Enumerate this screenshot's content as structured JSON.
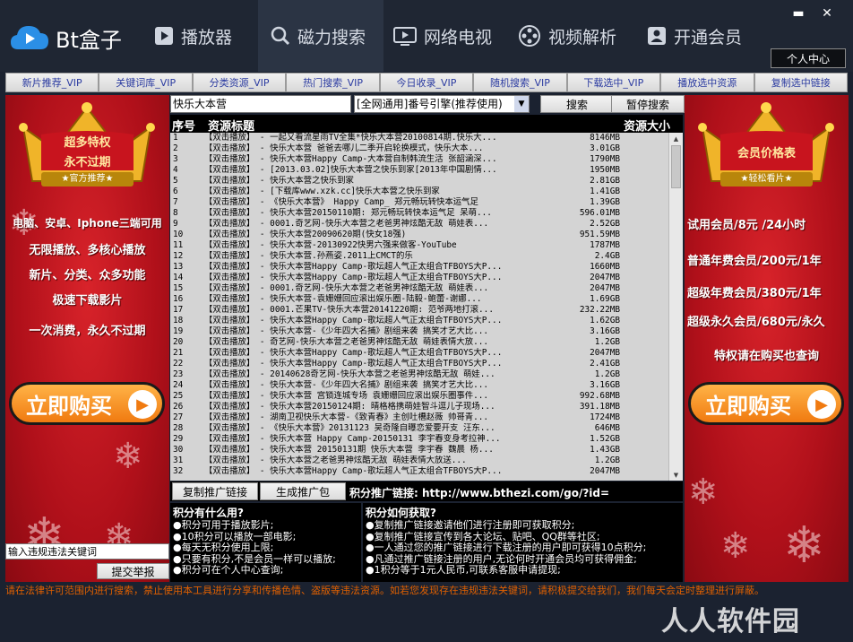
{
  "app": {
    "name": "Bt盒子",
    "user_center": "个人中心"
  },
  "nav": [
    {
      "label": "播放器",
      "icon": "play-icon"
    },
    {
      "label": "磁力搜索",
      "icon": "search-icon"
    },
    {
      "label": "网络电视",
      "icon": "tv-icon"
    },
    {
      "label": "视频解析",
      "icon": "film-reel-icon"
    },
    {
      "label": "开通会员",
      "icon": "user-badge-icon"
    }
  ],
  "window": {
    "minimize": "▬",
    "close": "✕"
  },
  "tabs": [
    "新片推荐_VIP",
    "关键词库_VIP",
    "分类资源_VIP",
    "热门搜索_VIP",
    "今日收录_VIP",
    "随机搜索_VIP",
    "下载选中_VIP",
    "播放选中资源",
    "复制选中链接"
  ],
  "search": {
    "query": "快乐大本营",
    "engine": "[全网通用]番号引擎(推荐使用)",
    "search_btn": "搜索",
    "pause_btn": "暂停搜索"
  },
  "list": {
    "headers": {
      "index": "序号",
      "title": "资源标题",
      "size": "资源大小"
    },
    "rows": [
      {
        "n": "1",
        "t": "【双击播放】 - 一起又看流星雨TV全集*快乐大本营20100814期.快乐大...",
        "s": "8146MB"
      },
      {
        "n": "2",
        "t": "【双击播放】 - 快乐大本营 爸爸去哪儿二季开启轮换模式，快乐大本...",
        "s": "3.01GB"
      },
      {
        "n": "3",
        "t": "【双击播放】 - 快乐大本营Happy Camp-大本营自制韩流生活 张韶涵深...",
        "s": "1790MB"
      },
      {
        "n": "4",
        "t": "【双击播放】 - [2013.03.02]快乐大本营之快乐到家[2013年中国剧情...",
        "s": "1950MB"
      },
      {
        "n": "5",
        "t": "【双击播放】 - 快乐大本营之快乐到家",
        "s": "2.81GB"
      },
      {
        "n": "6",
        "t": "【双击播放】 - [下载库www.xzk.cc]快乐大本营之快乐到家",
        "s": "1.41GB"
      },
      {
        "n": "7",
        "t": "【双击播放】 - 《快乐大本营》 Happy Camp_ 郑元畅玩转快本运气足",
        "s": "1.39GB"
      },
      {
        "n": "8",
        "t": "【双击播放】 - 快乐大本营20150110期: 郑元畅玩转快本运气足 呆萌...",
        "s": "596.01MB"
      },
      {
        "n": "9",
        "t": "【双击播放】 - 0001.奇艺网-快乐大本营之老爸男神炫酷无敌 萌娃表...",
        "s": "2.52GB"
      },
      {
        "n": "10",
        "t": "【双击播放】 - 快乐大本营20090620期(快女18强)",
        "s": "951.59MB"
      },
      {
        "n": "11",
        "t": "【双击播放】 - 快乐大本营-20130922快男六强来做客-YouTube",
        "s": "1787MB"
      },
      {
        "n": "12",
        "t": "【双击播放】 - 快乐大本营.孙燕姿.2011上CMCT的乐",
        "s": "2.4GB"
      },
      {
        "n": "13",
        "t": "【双击播放】 - 快乐大本营Happy Camp-歌坛超人气正太组合TFBOYS大P...",
        "s": "1660MB"
      },
      {
        "n": "14",
        "t": "【双击播放】 - 快乐大本营Happy Camp-歌坛超人气正太组合TFBOYS大P...",
        "s": "2047MB"
      },
      {
        "n": "15",
        "t": "【双击播放】 - 0001.奇艺网-快乐大本营之老爸男神炫酷无敌 萌娃表...",
        "s": "2047MB"
      },
      {
        "n": "16",
        "t": "【双击播放】 - 快乐大本营-袁姗姗回应滚出娱乐圈-陆毅-鲍蕾-谢娜...",
        "s": "1.69GB"
      },
      {
        "n": "17",
        "t": "【双击播放】 - 0001.芒果TV-快乐大本营20141220期: 范爷两地打滚...",
        "s": "232.22MB"
      },
      {
        "n": "18",
        "t": "【双击播放】 - 快乐大本营Happy Camp-歌坛超人气正太组合TFBOYS大P...",
        "s": "1.62GB"
      },
      {
        "n": "19",
        "t": "【双击播放】 - 快乐大本营-《少年四大名捕》剧组来袭 搞笑才艺大比...",
        "s": "3.16GB"
      },
      {
        "n": "20",
        "t": "【双击播放】 - 奇艺网-快乐大本营之老爸男神炫酷无敌 萌娃表情大放...",
        "s": "1.2GB"
      },
      {
        "n": "21",
        "t": "【双击播放】 - 快乐大本营Happy Camp-歌坛超人气正太组合TFBOYS大P...",
        "s": "2047MB"
      },
      {
        "n": "22",
        "t": "【双击播放】 - 快乐大本营Happy Camp-歌坛超人气正太组合TFBOYS大P...",
        "s": "2.41GB"
      },
      {
        "n": "23",
        "t": "【双击播放】 - 20140628奇艺网-快乐大本营之老爸男神炫酷无敌 萌娃...",
        "s": "1.2GB"
      },
      {
        "n": "24",
        "t": "【双击播放】 - 快乐大本营-《少年四大名捕》剧组来袭 搞笑才艺大比...",
        "s": "3.16GB"
      },
      {
        "n": "25",
        "t": "【双击播放】 - 快乐大本营 宫锁连城专场 袁姗姗回应滚出娱乐圈事件...",
        "s": "992.68MB"
      },
      {
        "n": "26",
        "t": "【双击播放】 - 快乐大本营20150124期: 晴格格携萌娃智斗逗儿子现场...",
        "s": "391.18MB"
      },
      {
        "n": "27",
        "t": "【双击播放】 - 湖南卫视快乐大本营-《致青春》主创吐槽赵薇 帅哥青...",
        "s": "1724MB"
      },
      {
        "n": "28",
        "t": "【双击播放】 - 《快乐大本营》20131123 吴奇隆自曝恋爱要开支 汪东...",
        "s": "646MB"
      },
      {
        "n": "29",
        "t": "【双击播放】 - 快乐大本营 Happy Camp-20150131 李宇春变身考拉神...",
        "s": "1.52GB"
      },
      {
        "n": "30",
        "t": "【双击播放】 - 快乐大本营 20150131期 快乐大本营 李宇春 魏晨 杨...",
        "s": "1.43GB"
      },
      {
        "n": "31",
        "t": "【双击播放】 - 快乐大本营之老爸男神炫酷无敌 萌娃表情大放送...",
        "s": "1.2GB"
      },
      {
        "n": "32",
        "t": "【双击播放】 - 快乐大本营Happy Camp-歌坛超人气正太组合TFBOYS大P...",
        "s": "2047MB"
      }
    ]
  },
  "link": {
    "copy_btn": "复制推广链接",
    "gen_btn": "生成推广包",
    "label": "积分推广链接: http://www.bthezi.com/go/?id="
  },
  "points_use": {
    "title": "积分有什么用?",
    "items": [
      "●积分可用于播放影片;",
      "●10积分可以播放一部电影;",
      "●每天无积分使用上限;",
      "●只要有积分,不是会员一样可以播放;",
      "●积分可在个人中心查询;"
    ]
  },
  "points_get": {
    "title": "积分如何获取?",
    "items": [
      "●复制推广链接邀请他们进行注册即可获取积分;",
      "●复制推广链接宣传到各大论坛、贴吧、QQ群等社区;",
      "●一人通过您的推广链接进行下载注册的用户即可获得10点积分;",
      "●凡通过推广链接注册的用户,无论何时开通会员均可获得佣金;",
      "●1积分等于1元人民币,可联系客服申请提现;"
    ]
  },
  "ad_left": {
    "crown_1": "超多特权",
    "crown_2": "永不过期",
    "ribbon": "★官方推荐★",
    "lines": [
      "电脑、安卓、Iphone三端可用",
      "无限播放、多核心播放",
      "新片、分类、众多功能",
      "极速下载影片",
      "一次消费，永久不过期"
    ],
    "buy": "立即购买"
  },
  "ad_right": {
    "crown_1": "会员价格表",
    "ribbon": "★轻松看片★",
    "lines": [
      "试用会员/8元 /24小时",
      "普通年费会员/200元/1年",
      "超级年费会员/380元/1年",
      "超级永久会员/680元/永久",
      "特权请在购买也查询"
    ],
    "buy": "立即购买"
  },
  "report": {
    "placeholder": "输入违规违法关键词",
    "btn": "提交举报"
  },
  "notice": "请在法律许可范围内进行搜索，禁止使用本工具进行分享和传播色情、盗版等违法资源。如若您发现存在违规违法关键词，请积极提交给我们，我们每天会定时整理进行屏蔽。",
  "watermark": "人人软件园",
  "colors": {
    "accent": "#2b8fe6",
    "tab_text": "#2a3aa0",
    "notice": "#e06000",
    "ad_red": "#c8141e"
  }
}
